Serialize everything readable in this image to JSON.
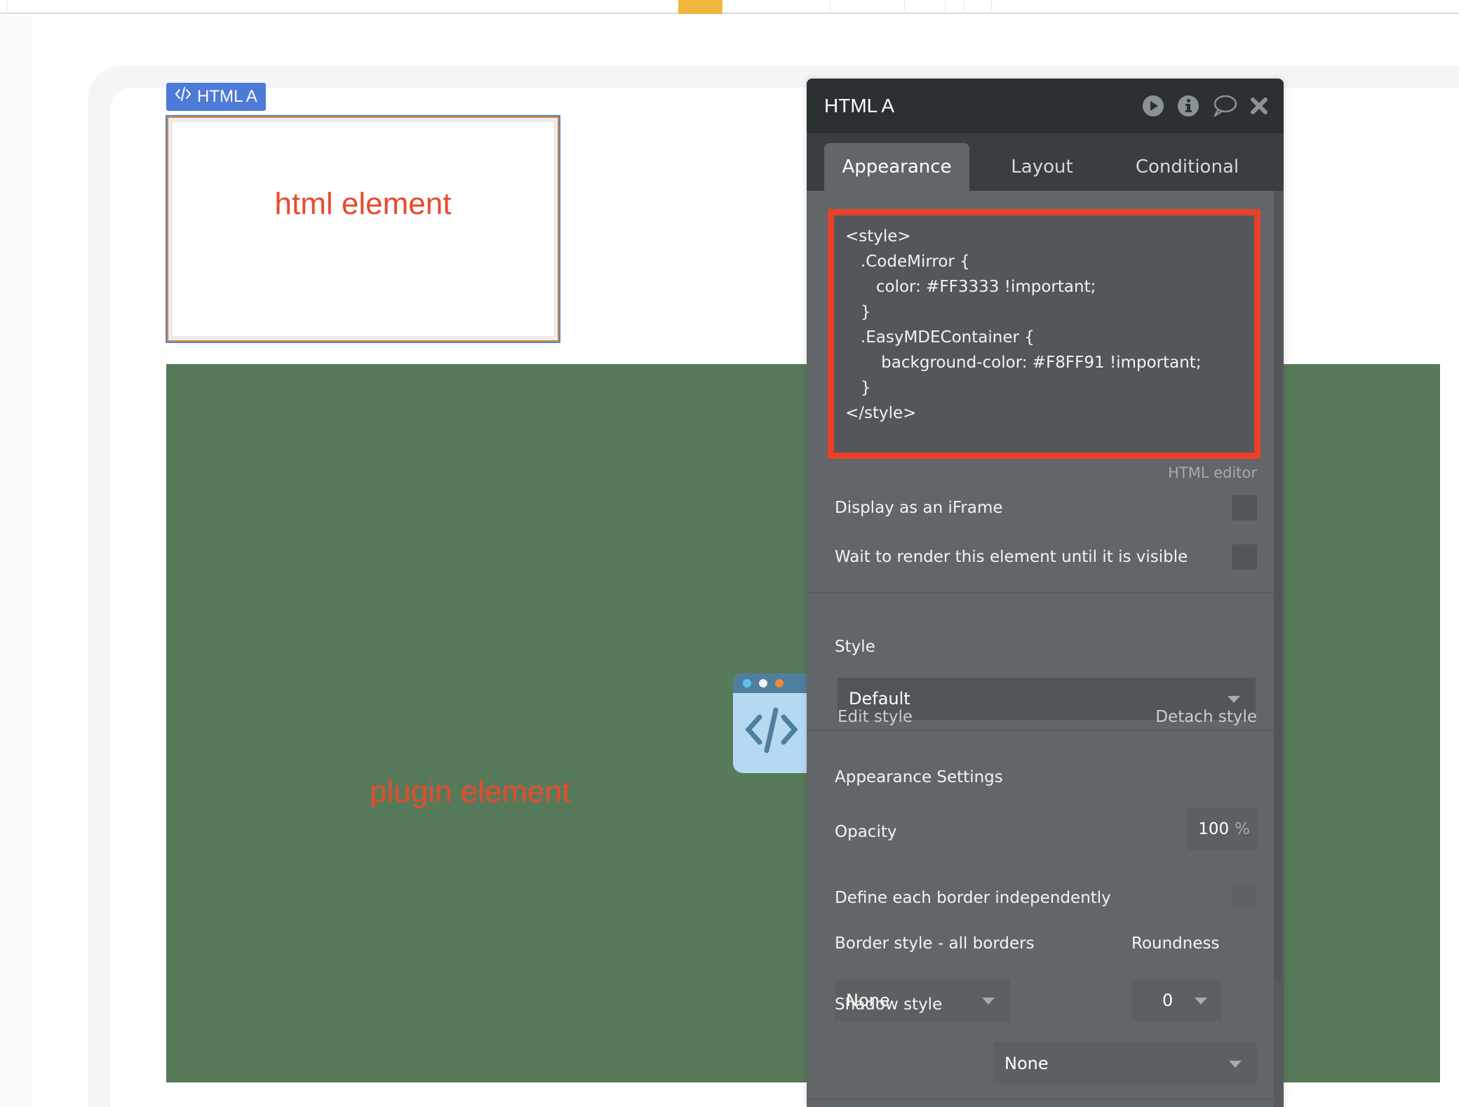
{
  "canvas": {
    "element_label": "HTML A",
    "element_label_icon": "code-brackets-icon",
    "html_element_text": "html element",
    "plugin_element_text": "plugin element",
    "plugin_icon": "code-window-icon",
    "colors": {
      "label_bg": "#4e7ad8",
      "element_text": "#e84a2c",
      "plugin_bg": "#577a5a"
    }
  },
  "panel": {
    "title": "HTML A",
    "header_icons": [
      "play-icon",
      "info-icon",
      "comment-icon",
      "close-icon"
    ],
    "tabs": [
      {
        "label": "Appearance",
        "active": true
      },
      {
        "label": "Layout",
        "active": false
      },
      {
        "label": "Conditional",
        "active": false
      }
    ],
    "html_editor": {
      "lines": [
        "<style>",
        "   .CodeMirror {",
        "      color: #FF3333 !important;",
        "   }",
        "",
        "   .EasyMDEContainer {",
        "       background-color: #F8FF91 !important;",
        "   }",
        "</style>"
      ],
      "label": "HTML editor",
      "highlight_color": "#e8412a"
    },
    "display_iframe": {
      "label": "Display as an iFrame",
      "checked": false
    },
    "wait_render": {
      "label": "Wait to render this element until it is visible",
      "checked": false
    },
    "style": {
      "label": "Style",
      "value": "Default",
      "edit_link": "Edit style",
      "detach_link": "Detach style"
    },
    "appearance_settings": {
      "heading": "Appearance Settings",
      "opacity_label": "Opacity",
      "opacity_value": "100",
      "opacity_unit": "%",
      "define_borders_label": "Define each border independently",
      "define_borders_checked": false,
      "border_style_label": "Border style - all borders",
      "border_style_value": "None",
      "roundness_label": "Roundness",
      "roundness_value": "0",
      "shadow_label": "Shadow style",
      "shadow_value": "None"
    }
  }
}
